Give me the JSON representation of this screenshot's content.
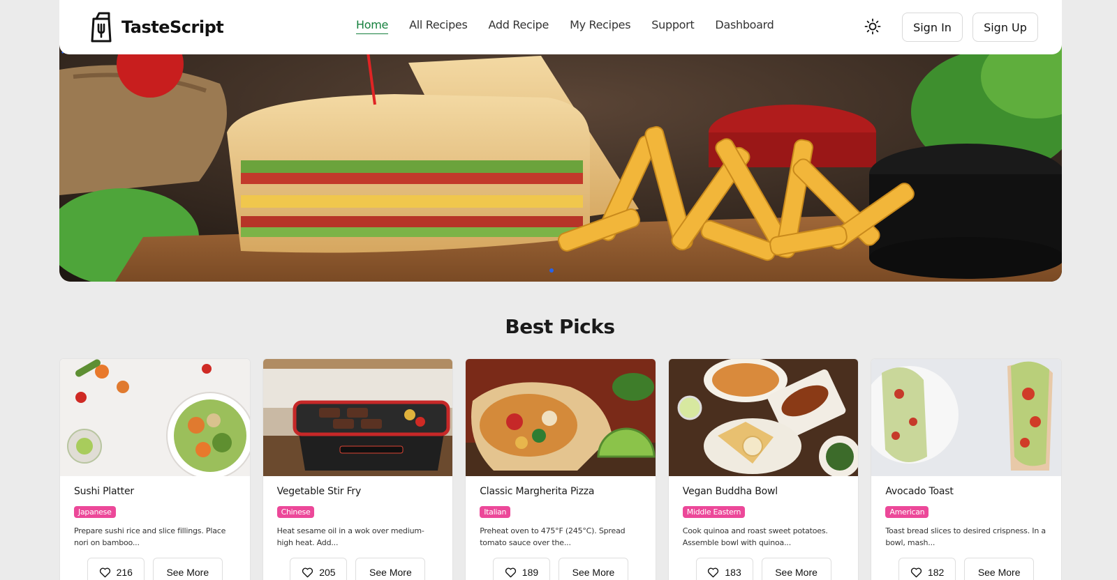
{
  "brand": {
    "name": "TasteScript",
    "logo_icon": "fork-bag-icon"
  },
  "nav": {
    "links": [
      {
        "label": "Home",
        "active": true
      },
      {
        "label": "All Recipes",
        "active": false
      },
      {
        "label": "Add Recipe",
        "active": false
      },
      {
        "label": "My Recipes",
        "active": false
      },
      {
        "label": "Support",
        "active": false
      },
      {
        "label": "Dashboard",
        "active": false
      }
    ],
    "theme_icon": "sun-icon",
    "sign_in": "Sign In",
    "sign_up": "Sign Up"
  },
  "hero": {
    "prev_icon": "chevron-left-icon",
    "next_icon": "chevron-right-icon",
    "accent": "#2563eb"
  },
  "section": {
    "title": "Best Picks"
  },
  "colors": {
    "accent_green": "#15803d",
    "tag_pink": "#ec4899"
  },
  "cards": [
    {
      "title": "Sushi Platter",
      "cuisine": "Japanese",
      "description": "Prepare sushi rice and slice fillings. Place nori on bamboo...",
      "likes": "216",
      "cta": "See More"
    },
    {
      "title": "Vegetable Stir Fry",
      "cuisine": "Chinese",
      "description": "Heat sesame oil in a wok over medium-high heat. Add...",
      "likes": "205",
      "cta": "See More"
    },
    {
      "title": "Classic Margherita Pizza",
      "cuisine": "Italian",
      "description": "Preheat oven to 475°F (245°C). Spread tomato sauce over the...",
      "likes": "189",
      "cta": "See More"
    },
    {
      "title": "Vegan Buddha Bowl",
      "cuisine": "Middle Eastern",
      "description": "Cook quinoa and roast sweet potatoes. Assemble bowl with quinoa...",
      "likes": "183",
      "cta": "See More"
    },
    {
      "title": "Avocado Toast",
      "cuisine": "American",
      "description": "Toast bread slices to desired crispness. In a bowl, mash...",
      "likes": "182",
      "cta": "See More"
    }
  ]
}
